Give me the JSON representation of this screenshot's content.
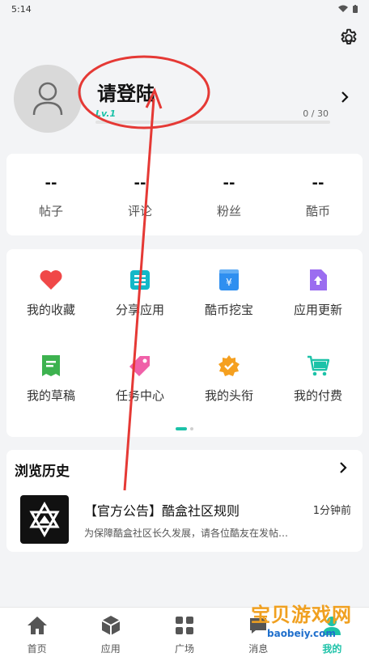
{
  "status_bar": {
    "time": "5:14"
  },
  "profile": {
    "username": "请登陆",
    "level": "Lv.1",
    "xp": "0 / 30",
    "xp_fraction": 0
  },
  "stats": [
    {
      "value": "--",
      "label": "帖子"
    },
    {
      "value": "--",
      "label": "评论"
    },
    {
      "value": "--",
      "label": "粉丝"
    },
    {
      "value": "--",
      "label": "酷币"
    }
  ],
  "features": [
    {
      "label": "我的收藏",
      "icon": "heart-icon",
      "color": "#f04848"
    },
    {
      "label": "分享应用",
      "icon": "share-app-icon",
      "color": "#12b8c8"
    },
    {
      "label": "酷币挖宝",
      "icon": "coin-box-icon",
      "color": "#2f8ff0"
    },
    {
      "label": "应用更新",
      "icon": "update-icon",
      "color": "#9b6df0"
    },
    {
      "label": "我的草稿",
      "icon": "draft-icon",
      "color": "#3db24f"
    },
    {
      "label": "任务中心",
      "icon": "tag-icon",
      "color": "#f060a8"
    },
    {
      "label": "我的头衔",
      "icon": "badge-icon",
      "color": "#f5a020"
    },
    {
      "label": "我的付费",
      "icon": "cart-icon",
      "color": "#1cc2a8"
    }
  ],
  "history": {
    "title": "浏览历史",
    "item": {
      "title": "【官方公告】酷盒社区规则",
      "time": "1分钟前",
      "desc": "为保障酷盒社区长久发展，请各位酷友在发帖…"
    }
  },
  "tabs": [
    {
      "label": "首页",
      "icon": "home-icon"
    },
    {
      "label": "应用",
      "icon": "app-cube-icon"
    },
    {
      "label": "广场",
      "icon": "grid-icon"
    },
    {
      "label": "消息",
      "icon": "message-icon"
    },
    {
      "label": "我的",
      "icon": "profile-icon"
    }
  ],
  "watermark": {
    "main": "宝贝游戏网",
    "sub": "baobeiy.com"
  },
  "colors": {
    "accent": "#1cc2a8",
    "annotation": "#e53935"
  }
}
